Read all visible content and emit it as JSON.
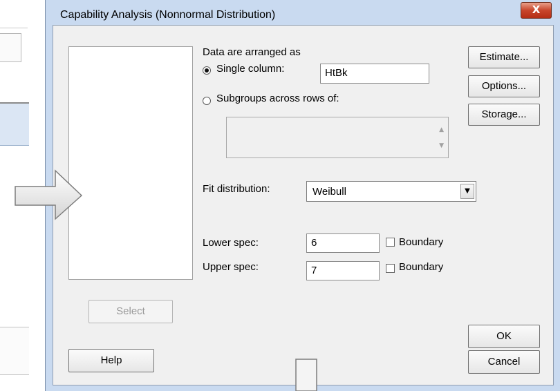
{
  "window": {
    "title": "Capability Analysis (Nonnormal Distribution)",
    "close_label": "X"
  },
  "data_arrangement": {
    "heading": "Data are arranged as",
    "single_column_label": "Single column:",
    "single_column_value": "HtBk",
    "subgroups_label": "Subgroups across rows of:",
    "subgroups_value": ""
  },
  "fit": {
    "label": "Fit distribution:",
    "selected": "Weibull"
  },
  "specs": {
    "lower_label": "Lower spec:",
    "lower_value": "6",
    "upper_label": "Upper spec:",
    "upper_value": "7",
    "boundary_label": "Boundary"
  },
  "buttons": {
    "estimate": "Estimate...",
    "options": "Options...",
    "storage": "Storage...",
    "select": "Select",
    "help": "Help",
    "ok": "OK",
    "cancel": "Cancel"
  },
  "colors": {
    "window_frame": "#c9daf0",
    "client_bg": "#f0f0f0",
    "close_red": "#c8452b"
  }
}
